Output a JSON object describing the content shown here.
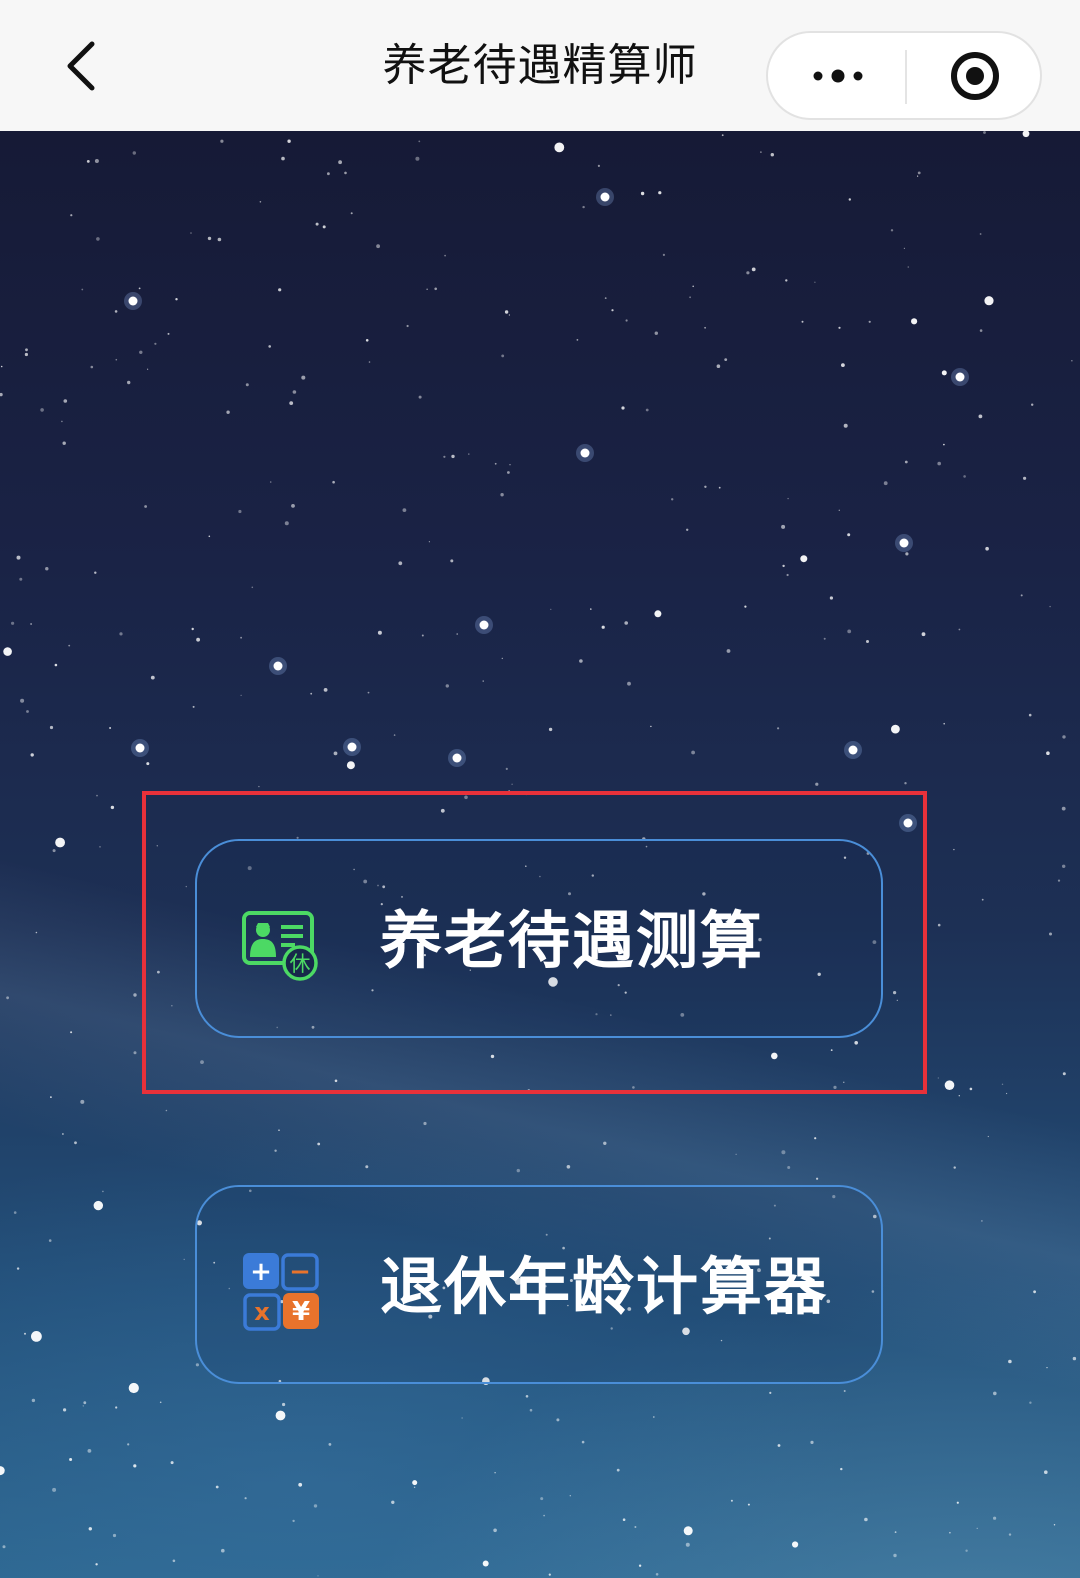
{
  "nav": {
    "title": "养老待遇精算师",
    "back_icon": "chevron-left-icon",
    "more_icon": "more-dots-icon",
    "close_icon": "target-circle-icon"
  },
  "menu": {
    "items": [
      {
        "label": "养老待遇测算",
        "icon": "pension-card-icon",
        "icon_badge": "休",
        "icon_color": "#4cd964",
        "highlighted": true
      },
      {
        "label": "退休年龄计算器",
        "icon": "calculator-icon",
        "icon_keys": [
          "+",
          "−",
          "x",
          "¥"
        ],
        "icon_colors": [
          "#3b7bd8",
          "#3b7bd8",
          "#3b7bd8",
          "#e8732c"
        ],
        "highlighted": false
      }
    ]
  },
  "colors": {
    "highlight_frame": "#e8313a",
    "button_border": "#4a8ed8",
    "nav_background": "#f7f7f7"
  }
}
